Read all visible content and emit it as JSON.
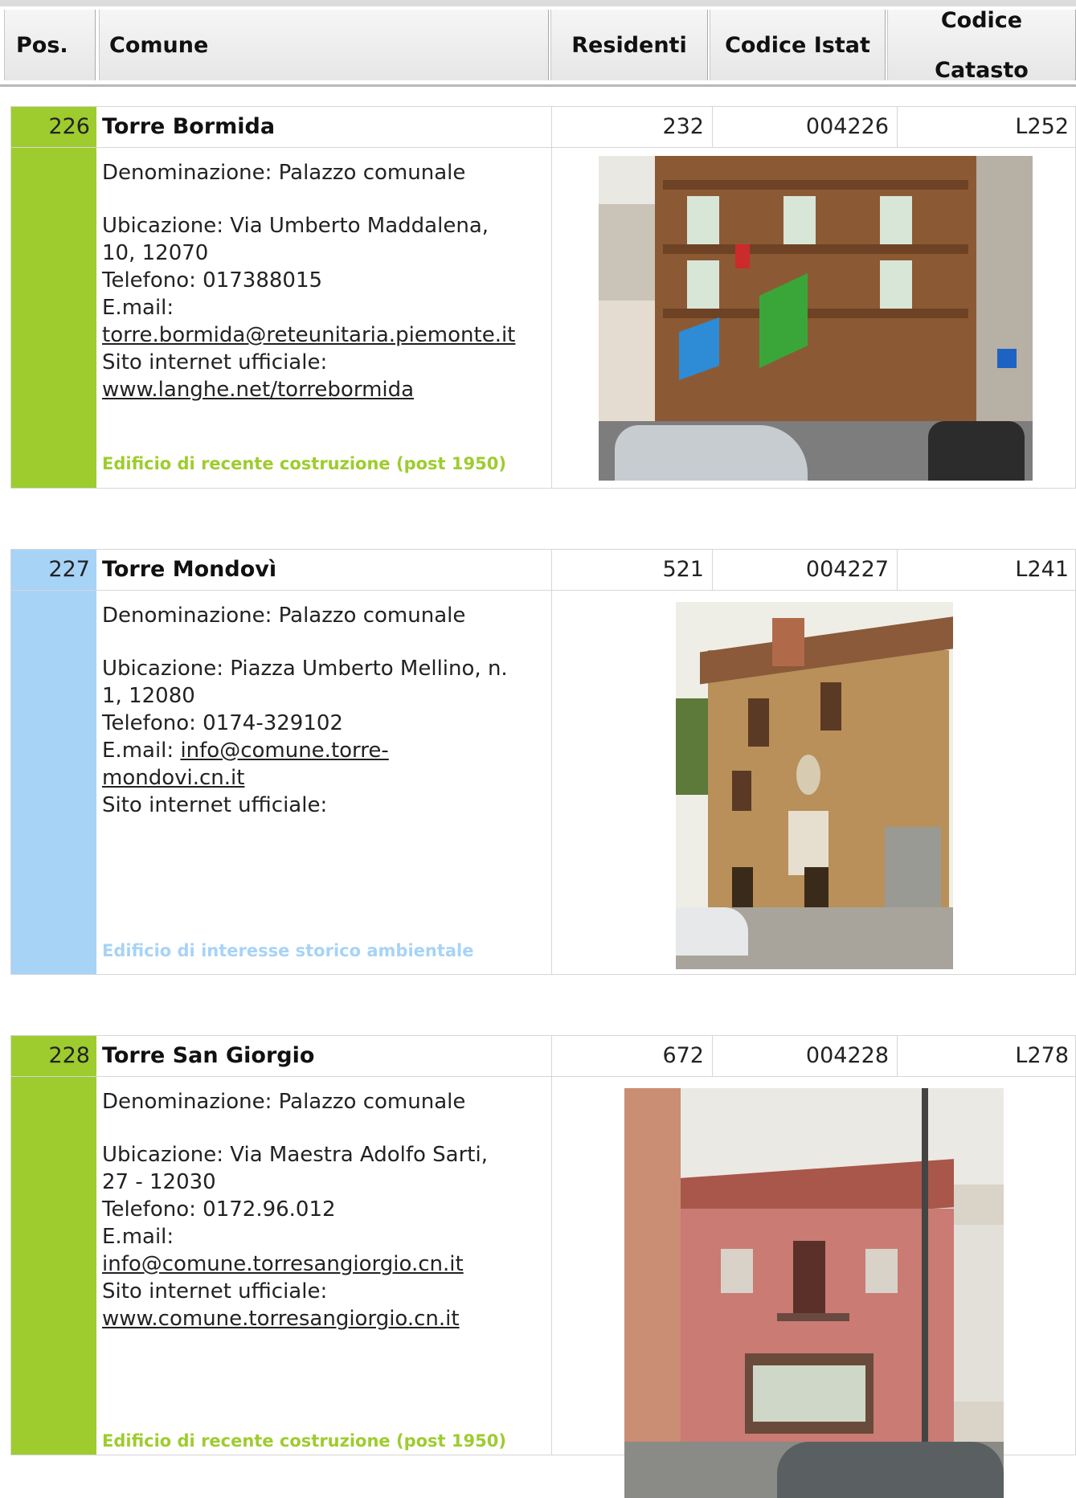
{
  "header": {
    "pos": "Pos.",
    "comune": "Comune",
    "residenti": "Residenti",
    "codice_istat": "Codice Istat",
    "codice_catasto_1": "Codice",
    "codice_catasto_2": "Catasto"
  },
  "entries": [
    {
      "pos": "226",
      "name": "Torre Bormida",
      "residenti": "232",
      "istat": "004226",
      "catasto": "L252",
      "denominazione": "Denominazione: Palazzo comunale",
      "ubicazione_1": "Ubicazione: Via Umberto Maddalena,",
      "ubicazione_2": "10, 12070",
      "telefono": "Telefono: 017388015",
      "email_label": "E.mail:",
      "email": "torre.bormida@reteunitaria.piemonte.it",
      "sito_label": "Sito internet ufficiale:",
      "sito": "www.langhe.net/torrebormida",
      "note": "Edificio di recente costruzione (post 1950)",
      "color": "#9ecc2e"
    },
    {
      "pos": "227",
      "name": "Torre Mondovì",
      "residenti": "521",
      "istat": "004227",
      "catasto": "L241",
      "denominazione": "Denominazione: Palazzo comunale",
      "ubicazione_1": "Ubicazione: Piazza Umberto Mellino, n.",
      "ubicazione_2": "1, 12080",
      "telefono": "Telefono: 0174-329102",
      "email_label": "E.mail:",
      "email_1": "info@comune.torre-",
      "email_2": "mondovi.cn.it",
      "sito_label": "Sito internet ufficiale:",
      "note": "Edificio di interesse storico ambientale",
      "color": "#a7d3f7"
    },
    {
      "pos": "228",
      "name": "Torre San Giorgio",
      "residenti": "672",
      "istat": "004228",
      "catasto": "L278",
      "denominazione": "Denominazione: Palazzo comunale",
      "ubicazione_1": "Ubicazione: Via Maestra Adolfo Sarti,",
      "ubicazione_2": "27 - 12030",
      "telefono": "Telefono: 0172.96.012",
      "email_label": "E.mail:",
      "email": "info@comune.torresangiorgio.cn.it",
      "sito_label": "Sito internet ufficiale:",
      "sito": "www.comune.torresangiorgio.cn.it",
      "note": "Edificio di recente costruzione (post 1950)",
      "color": "#9ecc2e"
    }
  ]
}
